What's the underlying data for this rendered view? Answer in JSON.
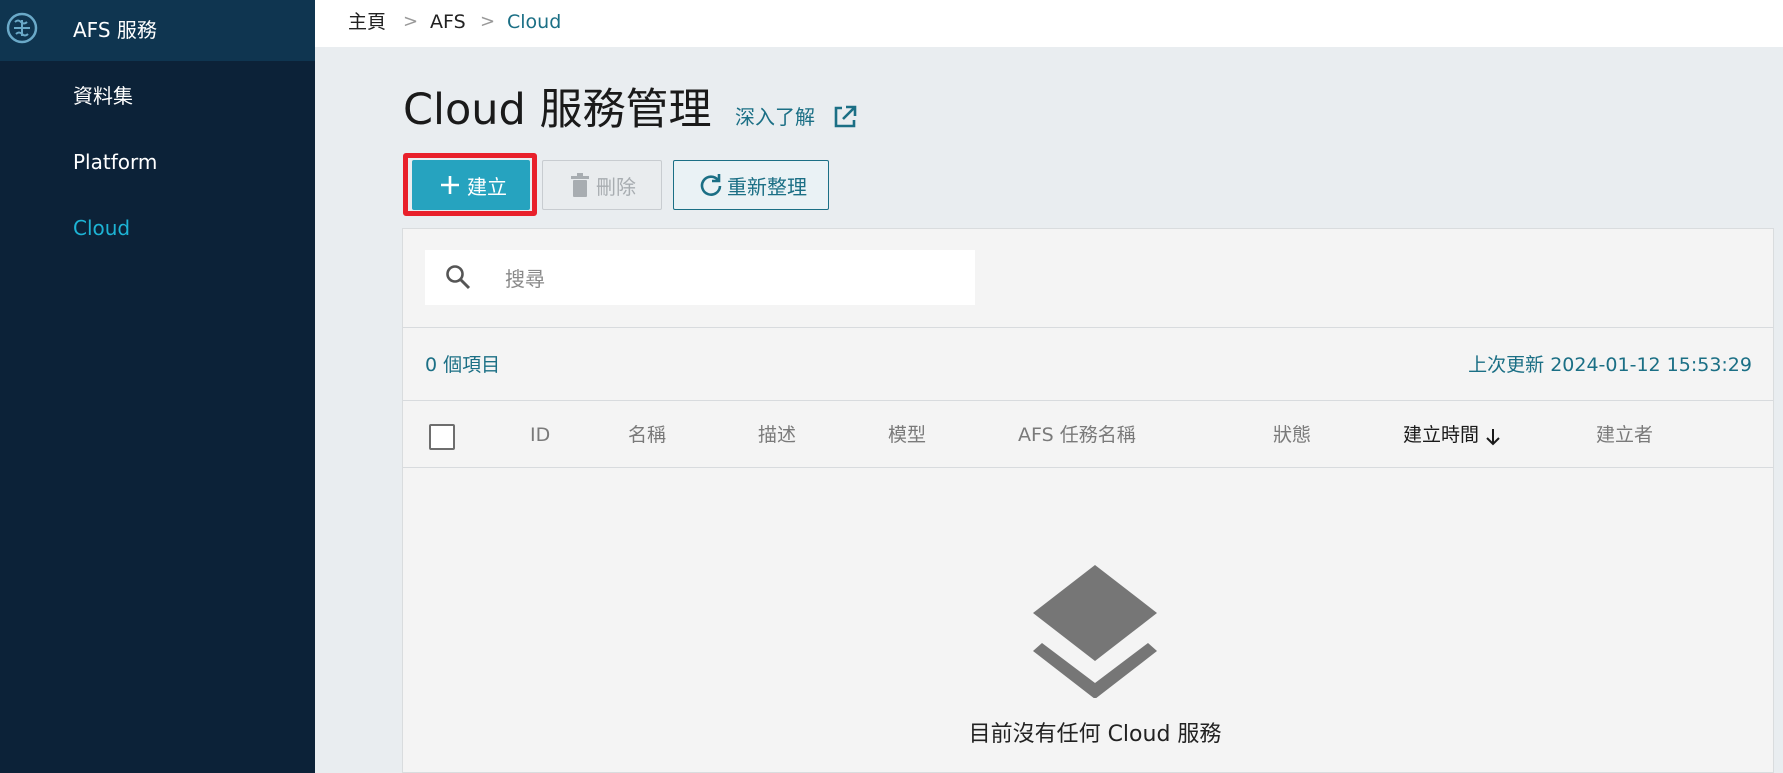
{
  "sidebar": {
    "logo": "afs-logo-icon",
    "title": "AFS 服務",
    "items": [
      {
        "label": "資料集",
        "active": false
      },
      {
        "label": "Platform",
        "active": false
      },
      {
        "label": "Cloud",
        "active": true
      }
    ],
    "colors": {
      "bg": "#0c2238",
      "top_bg": "#0f3550",
      "active": "#1db3d4"
    }
  },
  "breadcrumb": {
    "items": [
      "主頁",
      "AFS",
      "Cloud"
    ],
    "separator": ">"
  },
  "header": {
    "title": "Cloud 服務管理",
    "learn_more": "深入了解",
    "learn_more_icon": "external-link-icon"
  },
  "toolbar": {
    "create_label": "建立",
    "create_icon": "plus-icon",
    "delete_label": "刪除",
    "delete_icon": "trash-icon",
    "delete_disabled": true,
    "refresh_label": "重新整理",
    "refresh_icon": "refresh-icon",
    "highlight_color": "#e8202b",
    "accent": "#26a3bf"
  },
  "search": {
    "placeholder": "搜尋",
    "value": "",
    "icon": "search-icon"
  },
  "table": {
    "count_label": "0 個項目",
    "last_updated": "上次更新 2024-01-12 15:53:29",
    "columns": [
      "ID",
      "名稱",
      "描述",
      "模型",
      "AFS 任務名稱",
      "狀態",
      "建立時間",
      "建立者"
    ],
    "sorted_column": "建立時間",
    "sort_direction": "descending",
    "rows": []
  },
  "empty_state": {
    "icon": "layers-icon",
    "message": "目前沒有任何 Cloud 服務"
  }
}
